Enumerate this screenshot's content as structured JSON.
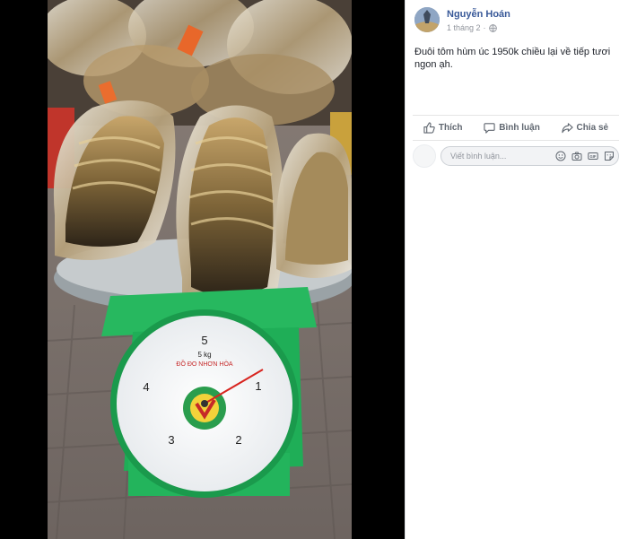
{
  "post": {
    "author": "Nguyễn Hoán",
    "time": "1 tháng 2",
    "privacy_icon": "globe-icon",
    "caption": "Đuôi tôm hùm úc 1950k chiều lại về tiếp tươi ngon ạh."
  },
  "actions": {
    "like": "Thích",
    "comment": "Bình luận",
    "share": "Chia sẻ"
  },
  "comment_input": {
    "placeholder": "Viết bình luận..."
  },
  "photo": {
    "description_icon": "lobster-tails-on-scale-photo",
    "scale": {
      "brand": "ĐỒ ĐO NHƠN HÒA",
      "capacity": "5 kg",
      "dial_numbers": [
        "5",
        "1",
        "2",
        "3",
        "4"
      ]
    }
  },
  "colors": {
    "link": "#385898",
    "scale_green": "#1fae57",
    "needle": "#d8241f"
  }
}
